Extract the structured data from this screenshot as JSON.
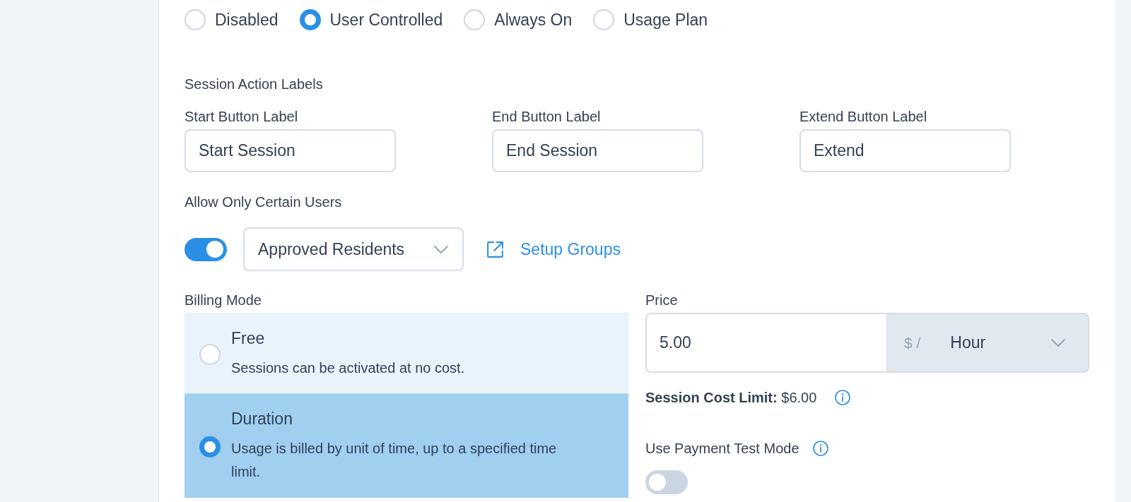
{
  "mode_options": [
    {
      "label": "Disabled",
      "selected": false
    },
    {
      "label": "User Controlled",
      "selected": true
    },
    {
      "label": "Always On",
      "selected": false
    },
    {
      "label": "Usage Plan",
      "selected": false
    }
  ],
  "session_action_labels": {
    "heading": "Session Action Labels",
    "fields": [
      {
        "label": "Start Button Label",
        "value": "Start Session"
      },
      {
        "label": "End Button Label",
        "value": "End Session"
      },
      {
        "label": "Extend Button Label",
        "value": "Extend"
      }
    ]
  },
  "allow_only_certain_users": {
    "label": "Allow Only Certain Users",
    "on": true,
    "group_select": {
      "value": "Approved Residents"
    },
    "setup_link": "Setup Groups"
  },
  "billing_mode": {
    "label": "Billing Mode",
    "options": [
      {
        "title": "Free",
        "description": "Sessions can be activated at no cost.",
        "selected": false
      },
      {
        "title": "Duration",
        "description": "Usage is billed by unit of time, up to a specified time limit.",
        "selected": true
      }
    ]
  },
  "price": {
    "label": "Price",
    "value": "5.00",
    "unit_prefix": "$ /",
    "unit": "Hour"
  },
  "session_cost_limit": "**Session Cost Limit:** $6.00",
  "payment_test_mode": {
    "label": "Use Payment Test Mode",
    "on": false
  }
}
